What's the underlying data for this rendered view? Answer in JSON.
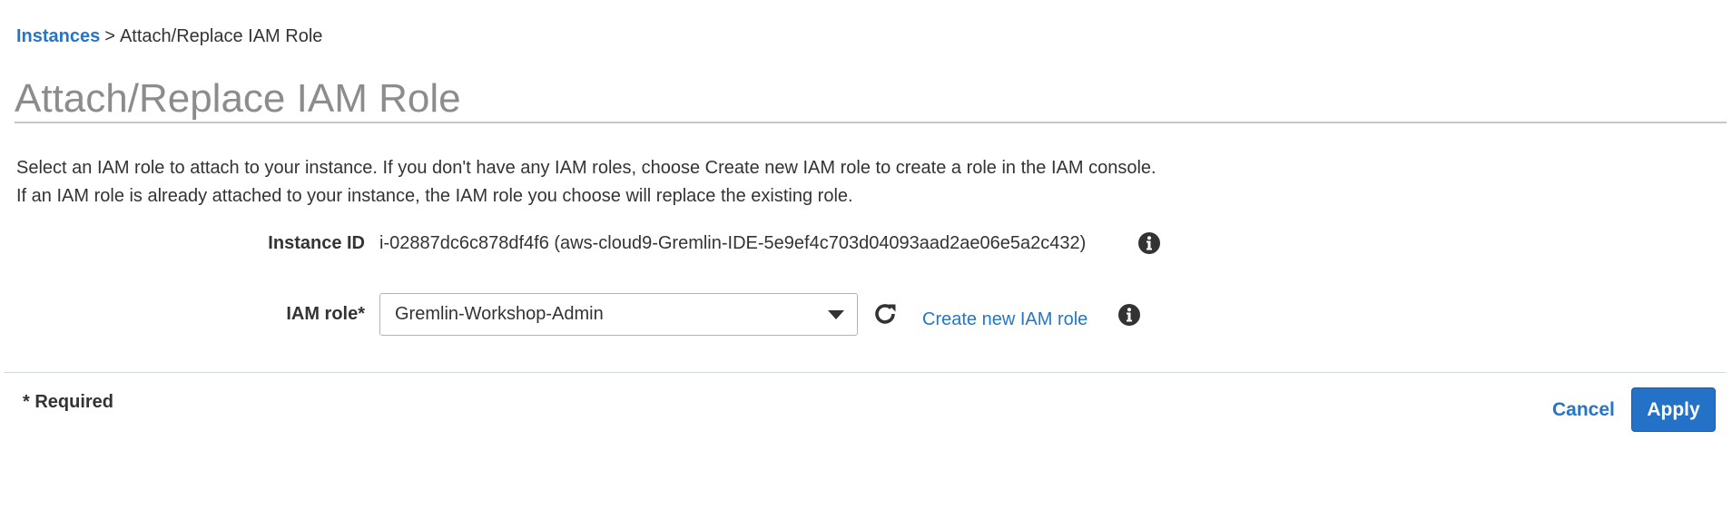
{
  "breadcrumb": {
    "parent": "Instances",
    "separator": ">",
    "current": "Attach/Replace IAM Role"
  },
  "page": {
    "title": "Attach/Replace IAM Role"
  },
  "description": {
    "line1": "Select an IAM role to attach to your instance. If you don't have any IAM roles, choose Create new IAM role to create a role in the IAM console.",
    "line2": "If an IAM role is already attached to your instance, the IAM role you choose will replace the existing role."
  },
  "form": {
    "instance_id_label": "Instance ID",
    "instance_id_value": "i-02887dc6c878df4f6 (aws-cloud9-Gremlin-IDE-5e9ef4c703d04093aad2ae06e5a2c432)",
    "iam_role_label": "IAM role*",
    "iam_role_selected": "Gremlin-Workshop-Admin",
    "create_role_link": "Create new IAM role"
  },
  "footer": {
    "required_note": "* Required",
    "cancel_label": "Cancel",
    "apply_label": "Apply"
  },
  "icons": {
    "info": "info-icon",
    "refresh": "refresh-icon",
    "dropdown": "chevron-down-icon"
  },
  "colors": {
    "link": "#2576c6",
    "primary_button": "#2372c7",
    "title": "#8c8c8c",
    "text": "#333333"
  }
}
